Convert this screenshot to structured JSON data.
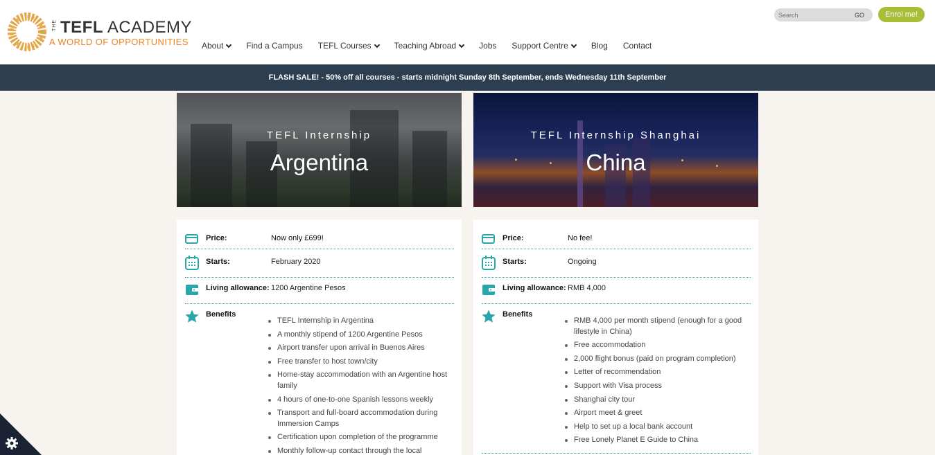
{
  "brand": {
    "the": "THE",
    "title_bold": "TEFL",
    "title_rest": " ACADEMY",
    "tagline": "A WORLD OF OPPORTUNITIES"
  },
  "nav": [
    {
      "label": "About",
      "dropdown": true
    },
    {
      "label": "Find a Campus",
      "dropdown": false
    },
    {
      "label": "TEFL Courses",
      "dropdown": true
    },
    {
      "label": "Teaching Abroad",
      "dropdown": true
    },
    {
      "label": "Jobs",
      "dropdown": false
    },
    {
      "label": "Support Centre",
      "dropdown": true
    },
    {
      "label": "Blog",
      "dropdown": false
    },
    {
      "label": "Contact",
      "dropdown": false
    }
  ],
  "search": {
    "placeholder": "Search",
    "go_label": "GO"
  },
  "enrol_label": "Enrol me!",
  "flash_text": "FLASH SALE! - 50% off all courses - starts midnight Sunday 8th September, ends Wednesday 11th September",
  "colors": {
    "accent": "#2aa6a8",
    "enrol": "#a9bd37",
    "flash_bg": "#2c3e50",
    "logo_orange": "#e8872b"
  },
  "argentina": {
    "hero_sub": "TEFL Internship",
    "hero_title": "Argentina",
    "price_label": "Price:",
    "price_value": "Now only £699!",
    "starts_label": "Starts:",
    "starts_value": "February 2020",
    "allowance_label": "Living allowance:",
    "allowance_value": "1200 Argentine Pesos",
    "benefits_label": "Benefits",
    "benefits": [
      "TEFL Internship in Argentina",
      "A monthly stipend of 1200 Argentine Pesos",
      "Airport transfer upon arrival in Buenos Aires",
      "Free transfer to host town/city",
      "Home-stay accommodation with an Argentine host family",
      "4 hours of one-to-one Spanish lessons weekly",
      "Transport and full-board accommodation during Immersion Camps",
      "Certification upon completion of the programme",
      "Monthly follow-up contact through the local"
    ]
  },
  "china": {
    "hero_sub": "TEFL Internship Shanghai",
    "hero_title": "China",
    "price_label": "Price:",
    "price_value": "No fee!",
    "starts_label": "Starts:",
    "starts_value": "Ongoing",
    "allowance_label": "Living allowance:",
    "allowance_value": "RMB 4,000",
    "benefits_label": "Benefits",
    "benefits": [
      "RMB 4,000 per month stipend (enough for a good lifestyle in China)",
      "Free accommodation",
      "2,000 flight bonus (paid on program completion)",
      "Letter of recommendation",
      "Support with Visa process",
      "Shanghai city tour",
      "Airport meet & greet",
      "Help to set up a local bank account",
      "Free Lonely Planet E Guide to China"
    ]
  },
  "icons": {
    "price": "card-icon",
    "starts": "calendar-icon",
    "allowance": "wallet-icon",
    "benefits": "star-icon",
    "cookie": "gear-icon"
  }
}
